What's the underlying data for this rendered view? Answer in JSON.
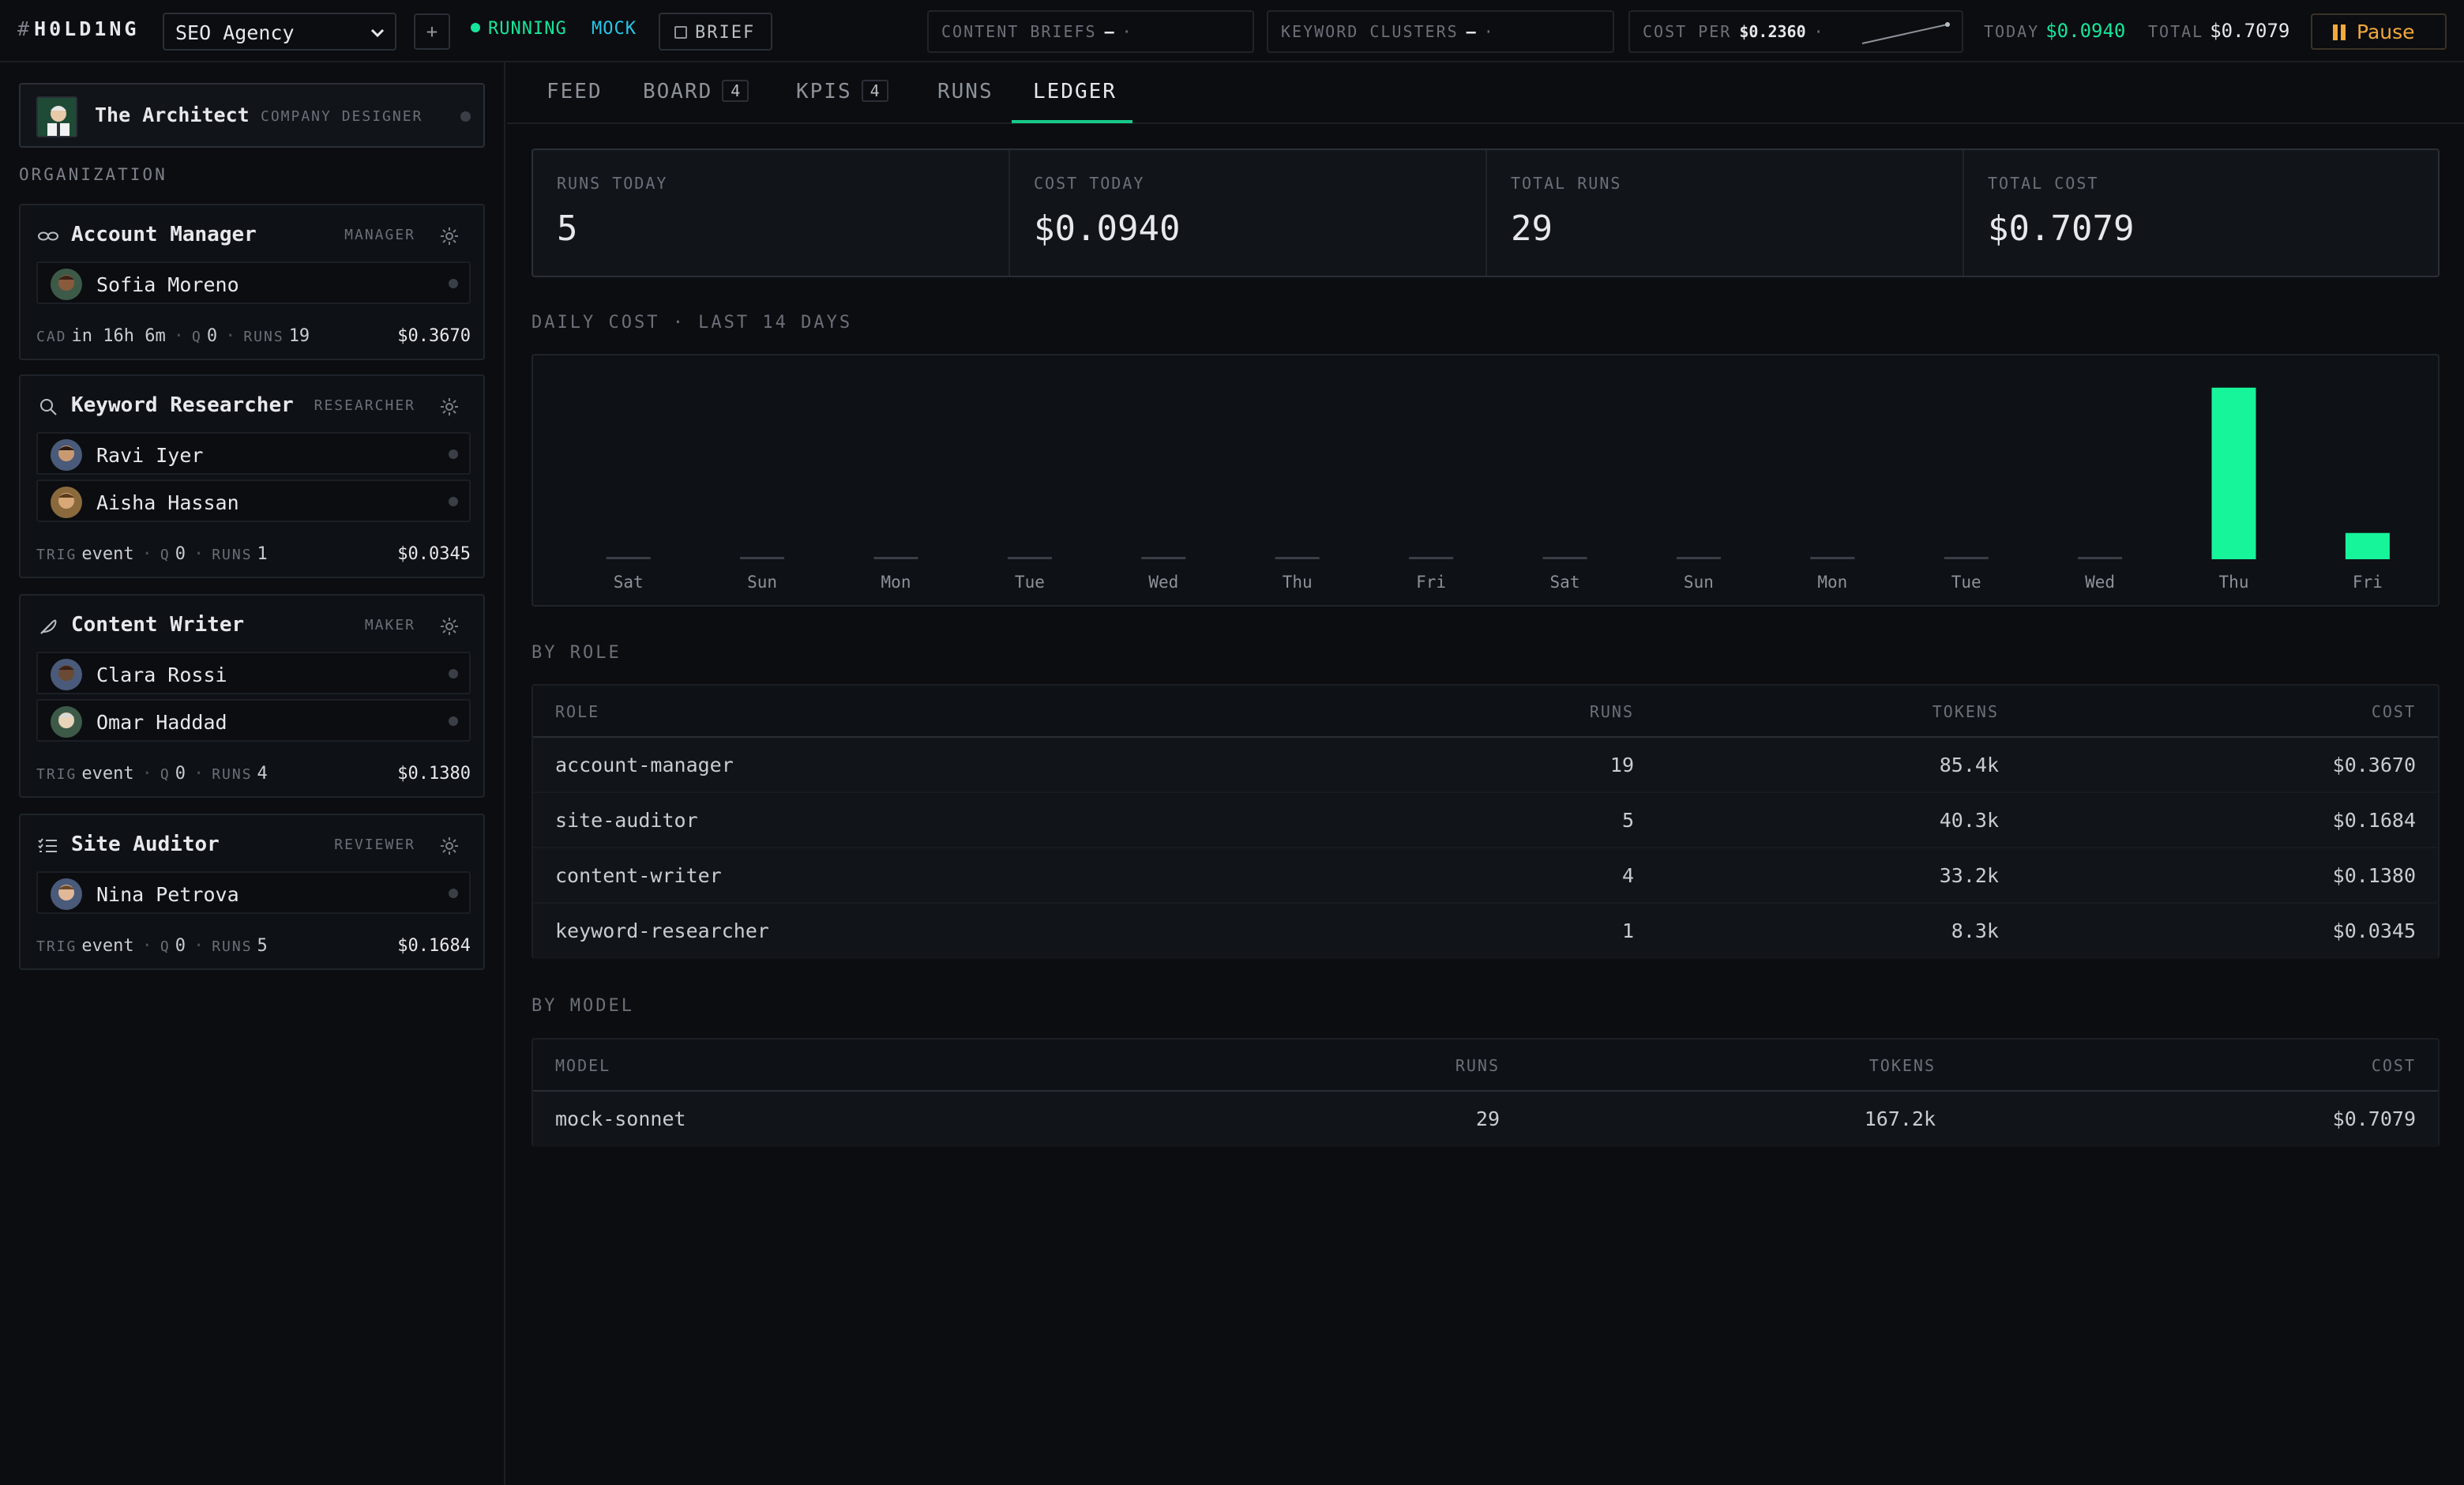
{
  "app": {
    "logo_hash": "#",
    "logo_text": "H0LD1NG",
    "company_select": "SEO Agency",
    "add_label": "+",
    "status": "RUNNING",
    "mode": "MOCK",
    "brief_label": "BRIEF"
  },
  "topbar": {
    "content_briefs_label": "CONTENT BRIEFS",
    "content_briefs_value": "—",
    "content_briefs_dot": "·",
    "keyword_clusters_label": "KEYWORD CLUSTERS",
    "keyword_clusters_value": "—",
    "keyword_clusters_dot": "·",
    "cost_per_label": "COST PER",
    "cost_per_value": "$0.2360",
    "cost_per_dot": "·",
    "today_label": "TODAY",
    "today_value": "$0.0940",
    "total_label": "TOTAL",
    "total_value": "$0.7079",
    "pause_label": "Pause",
    "colors": {
      "accent": "#17e59b",
      "mock": "#27c6e8",
      "pause": "#f2a93b"
    }
  },
  "sidebar": {
    "designer": {
      "name": "The Architect",
      "role": "COMPANY DESIGNER"
    },
    "org_label": "ORGANIZATION",
    "roles": [
      {
        "title": "Account Manager",
        "tag": "MANAGER",
        "icon": "link-icon",
        "agents": [
          "Sofia Moreno"
        ],
        "foot_k1": "CAD",
        "foot_v1": "in 16h 6m",
        "q_label": "Q",
        "q_value": "0",
        "runs_label": "RUNS",
        "runs_value": "19",
        "cost": "$0.3670"
      },
      {
        "title": "Keyword Researcher",
        "tag": "RESEARCHER",
        "icon": "search-icon",
        "agents": [
          "Ravi Iyer",
          "Aisha Hassan"
        ],
        "foot_k1": "TRIG",
        "foot_v1": "event",
        "q_label": "Q",
        "q_value": "0",
        "runs_label": "RUNS",
        "runs_value": "1",
        "cost": "$0.0345"
      },
      {
        "title": "Content Writer",
        "tag": "MAKER",
        "icon": "feather-icon",
        "agents": [
          "Clara Rossi",
          "Omar Haddad"
        ],
        "foot_k1": "TRIG",
        "foot_v1": "event",
        "q_label": "Q",
        "q_value": "0",
        "runs_label": "RUNS",
        "runs_value": "4",
        "cost": "$0.1380"
      },
      {
        "title": "Site Auditor",
        "tag": "REVIEWER",
        "icon": "checklist-icon",
        "agents": [
          "Nina Petrova"
        ],
        "foot_k1": "TRIG",
        "foot_v1": "event",
        "q_label": "Q",
        "q_value": "0",
        "runs_label": "RUNS",
        "runs_value": "5",
        "cost": "$0.1684"
      }
    ]
  },
  "tabs": [
    {
      "label": "FEED"
    },
    {
      "label": "BOARD",
      "count": "4"
    },
    {
      "label": "KPIS",
      "count": "4"
    },
    {
      "label": "RUNS"
    },
    {
      "label": "LEDGER",
      "active": true
    }
  ],
  "kpis": [
    {
      "label": "RUNS TODAY",
      "value": "5"
    },
    {
      "label": "COST TODAY",
      "value": "$0.0940"
    },
    {
      "label": "TOTAL RUNS",
      "value": "29"
    },
    {
      "label": "TOTAL COST",
      "value": "$0.7079"
    }
  ],
  "daily_cost_label": "DAILY COST · LAST 14 DAYS",
  "chart_data": {
    "type": "bar",
    "categories": [
      "Sat",
      "Sun",
      "Mon",
      "Tue",
      "Wed",
      "Thu",
      "Fri",
      "Sat",
      "Sun",
      "Mon",
      "Tue",
      "Wed",
      "Thu",
      "Fri"
    ],
    "values": [
      0,
      0,
      0,
      0,
      0,
      0,
      0,
      0,
      0,
      0,
      0,
      0,
      0.6139,
      0.094
    ],
    "title": "DAILY COST · LAST 14 DAYS",
    "xlabel": "",
    "ylabel": "",
    "ylim": [
      0,
      0.65
    ],
    "grid": false,
    "bar_color": "#17f59b",
    "baseline_color": "#3a3f47"
  },
  "by_role": {
    "label": "BY ROLE",
    "headers": [
      "ROLE",
      "RUNS",
      "TOKENS",
      "COST"
    ],
    "rows": [
      [
        "account-manager",
        "19",
        "85.4k",
        "$0.3670"
      ],
      [
        "site-auditor",
        "5",
        "40.3k",
        "$0.1684"
      ],
      [
        "content-writer",
        "4",
        "33.2k",
        "$0.1380"
      ],
      [
        "keyword-researcher",
        "1",
        "8.3k",
        "$0.0345"
      ]
    ]
  },
  "by_model": {
    "label": "BY MODEL",
    "headers": [
      "MODEL",
      "RUNS",
      "TOKENS",
      "COST"
    ],
    "rows": [
      [
        "mock-sonnet",
        "29",
        "167.2k",
        "$0.7079"
      ]
    ]
  }
}
